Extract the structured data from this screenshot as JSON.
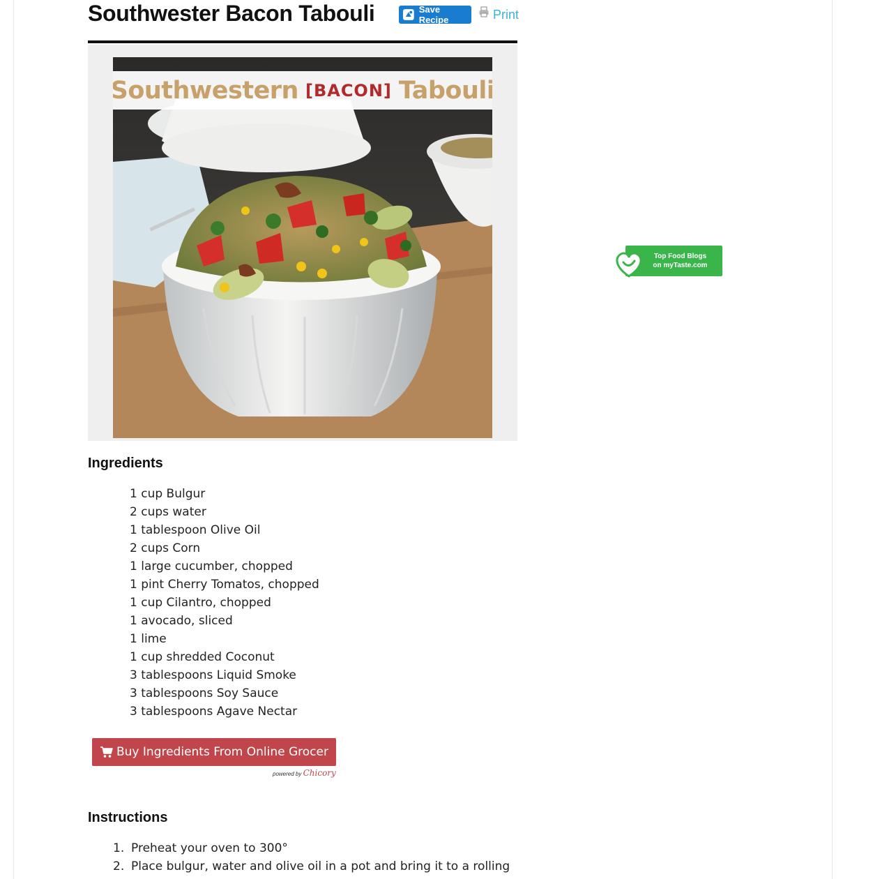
{
  "recipe": {
    "title": "Southwester Bacon Tabouli",
    "save_label": "Save Recipe",
    "print_label": "Print"
  },
  "image": {
    "banner_left": "Southwestern",
    "banner_middle": "[BACON]",
    "banner_right": "Tabouli"
  },
  "badge": {
    "line1": "Top Food Blogs",
    "line2": "on myTaste.com"
  },
  "ingredients": {
    "heading": "Ingredients",
    "items": [
      "1 cup Bulgur",
      "2 cups water",
      "1 tablespoon Olive Oil",
      "2 cups Corn",
      "1 large cucumber, chopped",
      "1 pint Cherry Tomatos, chopped",
      "1 cup Cilantro, chopped",
      "1 avocado, sliced",
      "1 lime",
      "1 cup shredded Coconut",
      "3 tablespoons Liquid Smoke",
      "3 tablespoons Soy Sauce",
      "3 tablespoons Agave Nectar"
    ]
  },
  "grocer": {
    "button_label": "Buy Ingredients From Online Grocer",
    "powered_by": "powered by",
    "brand": "Chicory"
  },
  "instructions": {
    "heading": "Instructions",
    "steps": [
      {
        "num": "1.",
        "text": "Preheat your oven to 300°"
      },
      {
        "num": "2.",
        "text": "Place bulgur, water and olive oil in a pot and bring it to a rolling"
      }
    ]
  },
  "colors": {
    "save_button": "#1a7ccf",
    "print_link": "#3ab3d8",
    "grocer_button": "#c0464b",
    "badge_green": "#39b54a",
    "banner_tan": "#c8a06a",
    "banner_red": "#b22a2a"
  }
}
